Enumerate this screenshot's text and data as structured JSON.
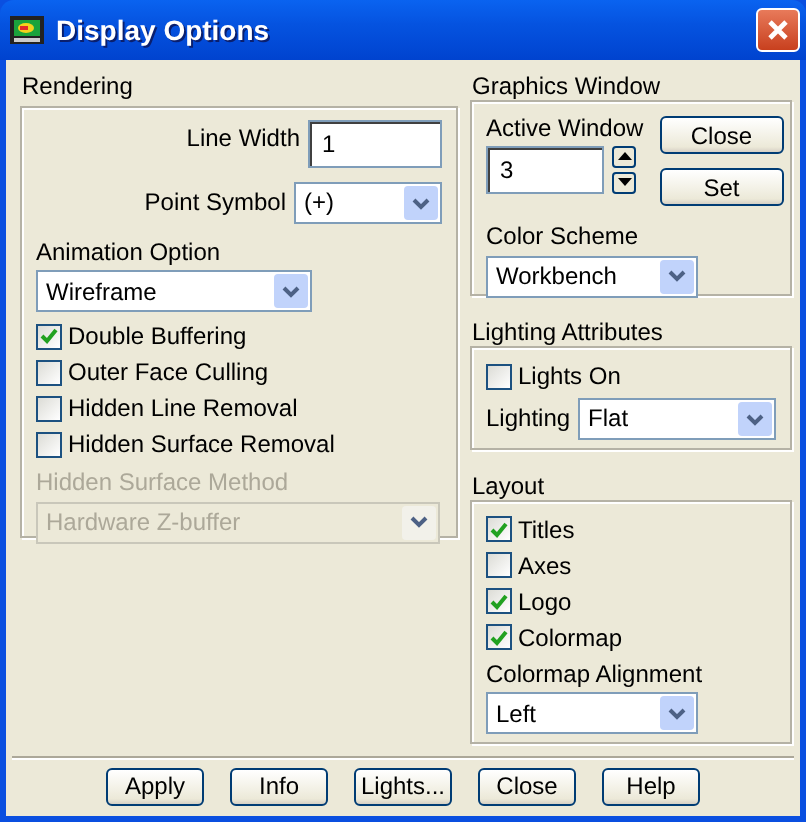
{
  "window": {
    "title": "Display Options"
  },
  "rendering": {
    "title": "Rendering",
    "line_width": {
      "label": "Line Width",
      "value": "1"
    },
    "point_symbol": {
      "label": "Point Symbol",
      "value": "(+)"
    },
    "animation_option": {
      "label": "Animation Option",
      "value": "Wireframe"
    },
    "checkboxes": [
      {
        "label": "Double Buffering",
        "checked": true
      },
      {
        "label": "Outer Face Culling",
        "checked": false
      },
      {
        "label": "Hidden Line Removal",
        "checked": false
      },
      {
        "label": "Hidden Surface Removal",
        "checked": false
      }
    ],
    "hidden_surface_method": {
      "label": "Hidden Surface Method",
      "value": "Hardware Z-buffer",
      "disabled": true
    }
  },
  "graphics_window": {
    "title": "Graphics Window",
    "active_window": {
      "label": "Active Window",
      "value": "3"
    },
    "buttons": [
      "Close",
      "Set"
    ],
    "color_scheme": {
      "label": "Color Scheme",
      "value": "Workbench"
    }
  },
  "lighting_attributes": {
    "title": "Lighting Attributes",
    "checkboxes": [
      {
        "label": "Lights On",
        "checked": false
      }
    ],
    "lighting": {
      "label": "Lighting",
      "value": "Flat"
    }
  },
  "layout": {
    "title": "Layout",
    "checkboxes": [
      {
        "label": "Titles",
        "checked": true
      },
      {
        "label": "Axes",
        "checked": false
      },
      {
        "label": "Logo",
        "checked": true
      },
      {
        "label": "Colormap",
        "checked": true
      }
    ],
    "colormap_alignment": {
      "label": "Colormap Alignment",
      "value": "Left"
    }
  },
  "buttons": [
    "Apply",
    "Info",
    "Lights...",
    "Close",
    "Help"
  ]
}
